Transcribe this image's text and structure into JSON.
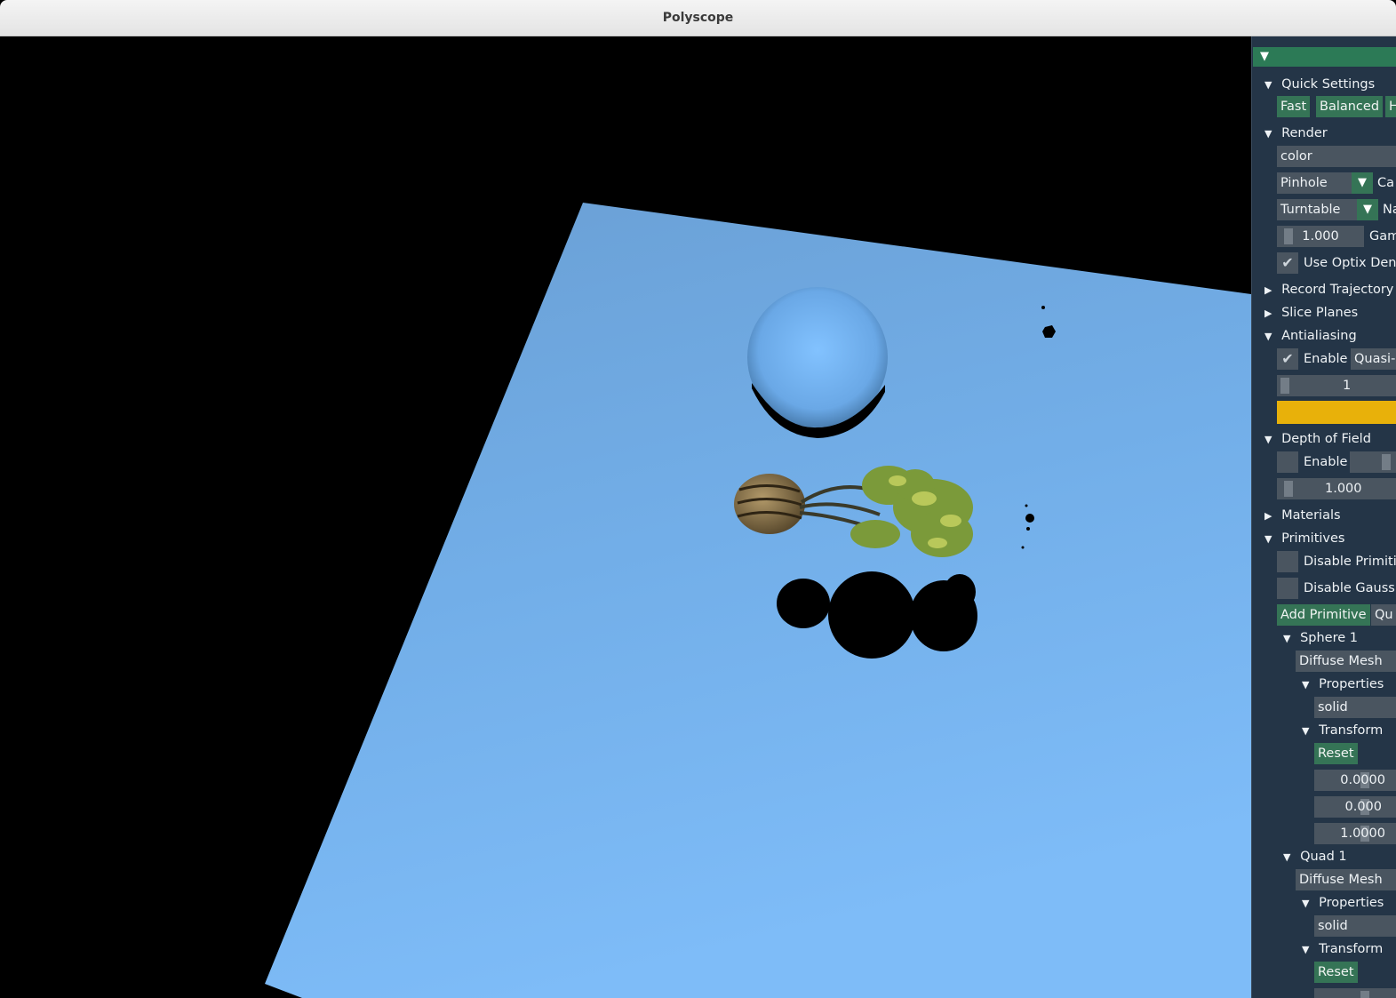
{
  "window": {
    "title": "Polyscope"
  },
  "colors": {
    "background": "#000000",
    "plane": "#7ab8f5",
    "panel_bg": "#243547",
    "accent_green": "#357456",
    "progress_yellow": "#e8b10a"
  },
  "panel": {
    "quick_settings": {
      "label": "Quick Settings",
      "buttons": [
        "Fast",
        "Balanced",
        "H"
      ]
    },
    "render": {
      "label": "Render",
      "mode_value": "color",
      "camera_value": "Pinhole",
      "camera_label": "Ca",
      "nav_value": "Turntable",
      "nav_label": "Na",
      "exposure_value": "1.000",
      "gamma_label": "Gam",
      "optix_label": "Use Optix Deno"
    },
    "record_trajectory": {
      "label": "Record Trajectory V"
    },
    "slice_planes": {
      "label": "Slice Planes"
    },
    "antialiasing": {
      "label": "Antialiasing",
      "enable_label": "Enable",
      "method_value": "Quasi-",
      "samples_value": "1"
    },
    "depth_of_field": {
      "label": "Depth of Field",
      "enable_label": "Enable",
      "value": "1.000"
    },
    "materials": {
      "label": "Materials"
    },
    "primitives": {
      "label": "Primitives",
      "disable_primitives_label": "Disable Primitiv",
      "disable_gaussians_label": "Disable Gaussia",
      "add_button": "Add Primitive",
      "type_value": "Qu",
      "sphere": {
        "label": "Sphere 1",
        "material": "Diffuse Mesh",
        "properties_label": "Properties",
        "properties_value": "solid",
        "transform_label": "Transform",
        "reset_label": "Reset",
        "values": [
          "0.0000",
          "0.000",
          "1.0000"
        ]
      },
      "quad": {
        "label": "Quad 1",
        "material": "Diffuse Mesh",
        "properties_label": "Properties",
        "properties_value": "solid",
        "transform_label": "Transform",
        "reset_label": "Reset"
      }
    }
  }
}
